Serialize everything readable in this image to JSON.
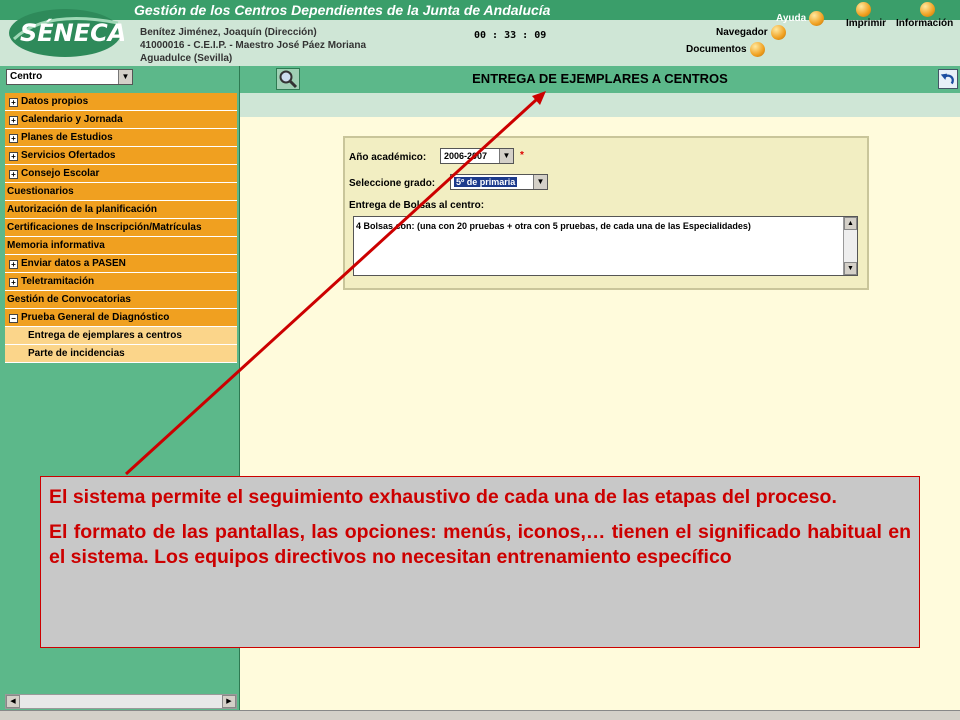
{
  "header": {
    "title": "Gestión de los Centros Dependientes de la Junta de Andalucía",
    "user": {
      "name": "Benítez Jiménez, Joaquín (Dirección)",
      "center": "41000016 - C.E.I.P. - Maestro José Páez Moriana",
      "location": "Aguadulce (Sevilla)"
    },
    "timer": "00 : 33 : 09",
    "links": {
      "ayuda": "Ayuda",
      "imprimir": "Imprimir",
      "informacion": "Información",
      "navegador": "Navegador",
      "documentos": "Documentos"
    }
  },
  "sidebar": {
    "select_value": "Centro",
    "items": [
      {
        "label": "Datos propios"
      },
      {
        "label": "Calendario y Jornada"
      },
      {
        "label": "Planes de Estudios"
      },
      {
        "label": "Servicios Ofertados"
      },
      {
        "label": "Consejo Escolar"
      },
      {
        "label": "Cuestionarios"
      },
      {
        "label": "Autorización de la planificación"
      },
      {
        "label": "Certificaciones de Inscripción/Matrículas"
      },
      {
        "label": "Memoria informativa"
      },
      {
        "label": "Enviar datos a PASEN"
      },
      {
        "label": "Teletramitación"
      },
      {
        "label": "Gestión de Convocatorias"
      },
      {
        "label": "Prueba General de Diagnóstico"
      },
      {
        "label": "Entrega de ejemplares a centros"
      },
      {
        "label": "Parte de incidencias"
      }
    ]
  },
  "main": {
    "page_title": "ENTREGA DE EJEMPLARES A CENTROS",
    "form": {
      "year_label": "Año académico:",
      "year_value": "2006-2007",
      "required": "*",
      "grade_label": "Seleccione grado:",
      "grade_value": "5º de primaria",
      "bags_label": "Entrega de Bolsas al centro:",
      "bags_text": "4 Bolsas con: (una con 20 pruebas + otra con 5 pruebas, de cada una de las Especialidades)"
    }
  },
  "note": {
    "p1": "El sistema permite el seguimiento exhaustivo de cada una de las etapas del proceso.",
    "p2": "El formato de las pantallas, las opciones: menús, iconos,… tienen el significado habitual en el sistema. Los equipos directivos no necesitan entrenamiento específico"
  },
  "colors": {
    "green": "#5cb88a",
    "orange": "#f0a020",
    "note_red": "#cc0000"
  }
}
